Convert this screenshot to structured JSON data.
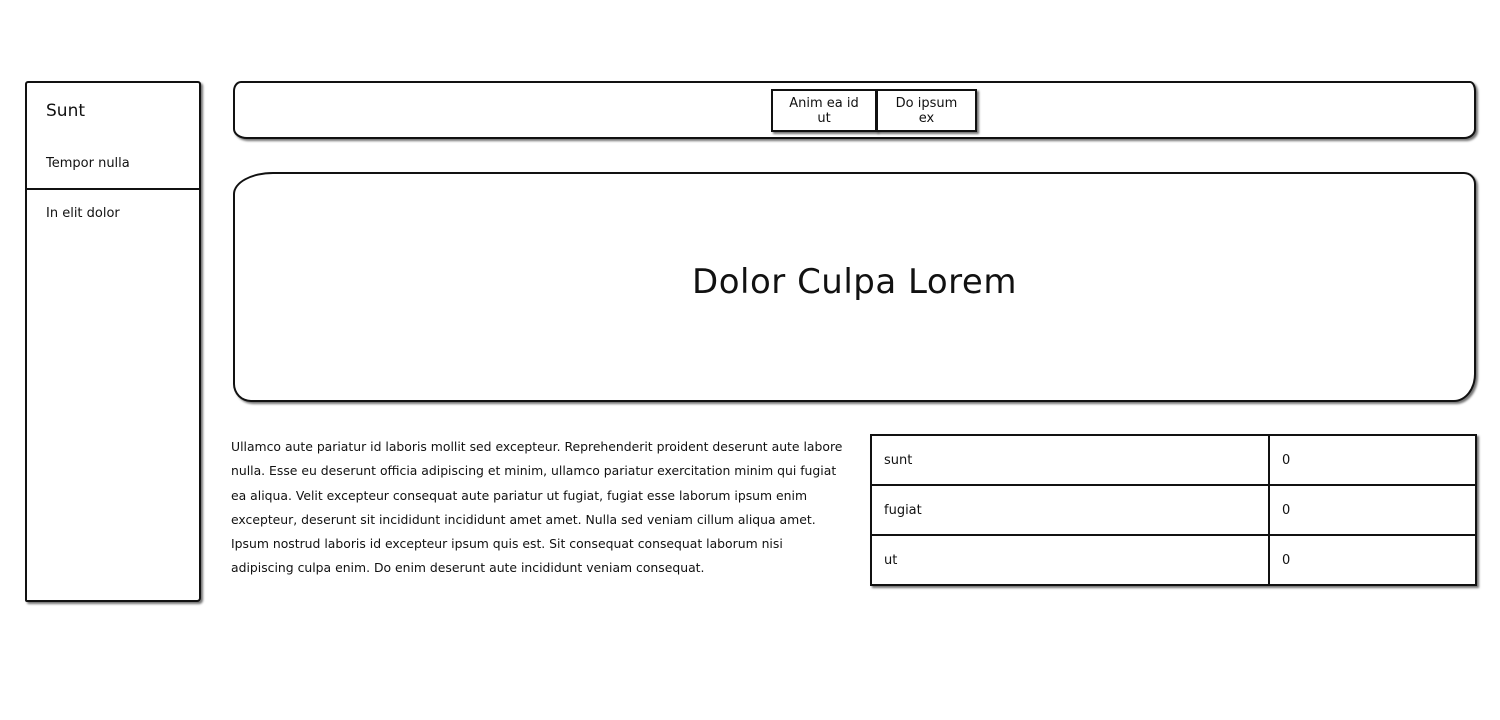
{
  "sidebar": {
    "brand": "Sunt",
    "items": [
      {
        "label": "Tempor nulla"
      },
      {
        "label": "In elit dolor"
      }
    ]
  },
  "topbar": {
    "buttons": [
      {
        "label": "Anim ea id ut"
      },
      {
        "label": "Do ipsum ex"
      }
    ]
  },
  "hero": {
    "title": "Dolor Culpa Lorem"
  },
  "body": {
    "paragraph": "Ullamco aute pariatur id laboris mollit sed excepteur. Reprehenderit proident deserunt aute labore nulla. Esse eu deserunt officia adipiscing et minim, ullamco pariatur exercitation minim qui fugiat ea aliqua. Velit excepteur consequat aute pariatur ut fugiat, fugiat esse laborum ipsum enim excepteur, deserunt sit incididunt incididunt amet amet. Nulla sed veniam cillum aliqua amet. Ipsum nostrud laboris id excepteur ipsum quis est. Sit consequat consequat laborum nisi adipiscing culpa enim. Do enim deserunt aute incididunt veniam consequat."
  },
  "table": {
    "rows": [
      {
        "label": "sunt",
        "value": "0"
      },
      {
        "label": "fugiat",
        "value": "0"
      },
      {
        "label": "ut",
        "value": "0"
      }
    ]
  }
}
